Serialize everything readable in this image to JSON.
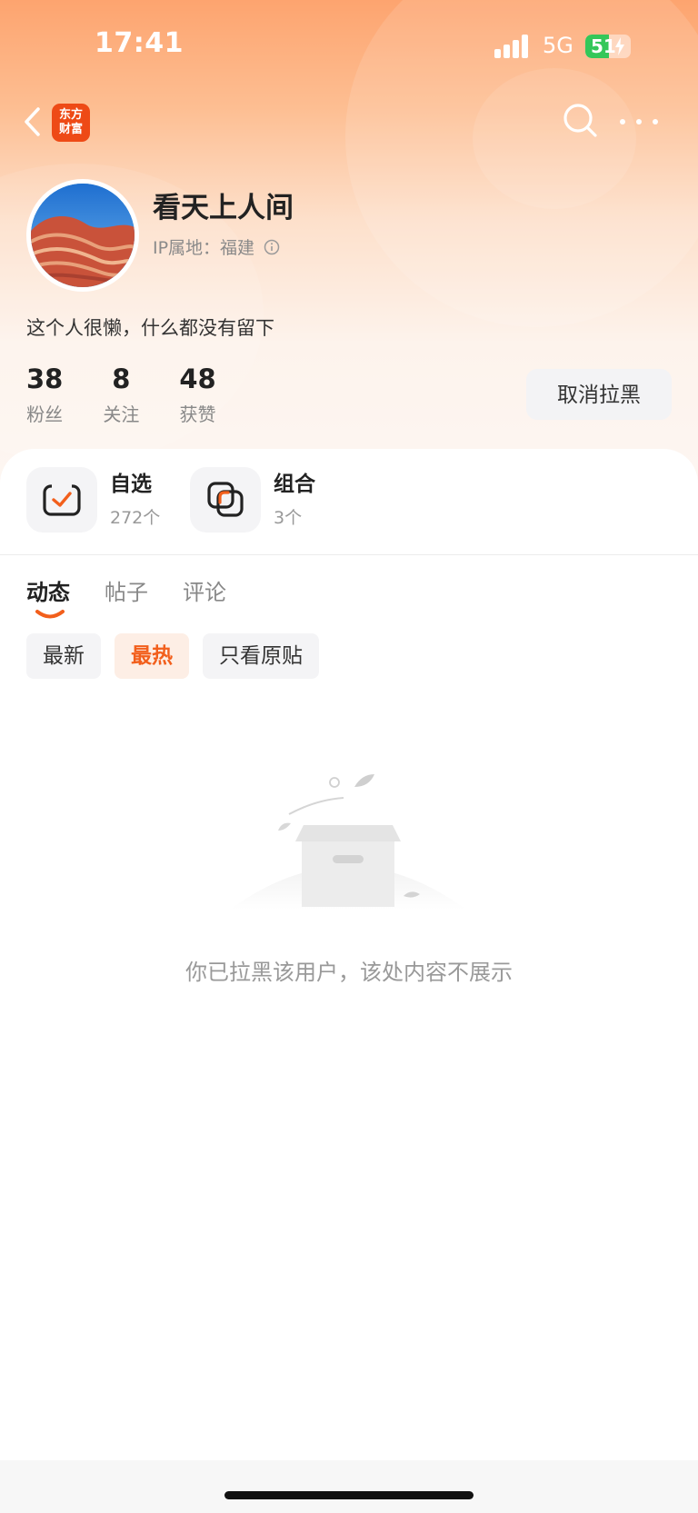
{
  "status_bar": {
    "time": "17:41",
    "network": "5G",
    "battery": "51",
    "battery_level": 0.51
  },
  "nav": {
    "app_logo_line1": "东方",
    "app_logo_line2": "财富"
  },
  "profile": {
    "nickname": "看天上人间",
    "ip_location": "IP属地：福建",
    "bio": "这个人很懒，什么都没有留下",
    "stats": [
      {
        "value": "38",
        "label": "粉丝"
      },
      {
        "value": "8",
        "label": "关注"
      },
      {
        "value": "48",
        "label": "获赞"
      }
    ],
    "unblock_label": "取消拉黑"
  },
  "quick_entries": [
    {
      "title": "自选",
      "count": "272个"
    },
    {
      "title": "组合",
      "count": "3个"
    }
  ],
  "tabs": [
    {
      "label": "动态",
      "active": true
    },
    {
      "label": "帖子",
      "active": false
    },
    {
      "label": "评论",
      "active": false
    }
  ],
  "filters": [
    {
      "label": "最新",
      "active": false
    },
    {
      "label": "最热",
      "active": true
    },
    {
      "label": "只看原贴",
      "active": false
    }
  ],
  "empty_state": {
    "message": "你已拉黑该用户，该处内容不展示"
  },
  "colors": {
    "accent": "#f25f1c",
    "logo": "#ee4a16",
    "battery": "#34c759"
  }
}
